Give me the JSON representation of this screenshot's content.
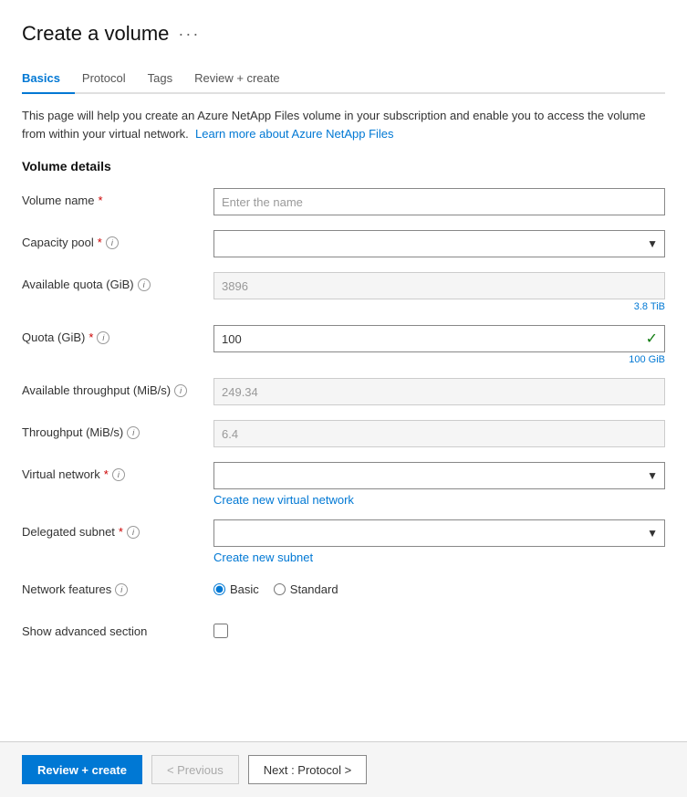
{
  "page": {
    "title": "Create a volume",
    "more_icon": "···"
  },
  "tabs": [
    {
      "id": "basics",
      "label": "Basics",
      "active": true
    },
    {
      "id": "protocol",
      "label": "Protocol",
      "active": false
    },
    {
      "id": "tags",
      "label": "Tags",
      "active": false
    },
    {
      "id": "review",
      "label": "Review + create",
      "active": false
    }
  ],
  "description": {
    "text": "This page will help you create an Azure NetApp Files volume in your subscription and enable you to access the volume from within your virtual network.",
    "link_text": "Learn more about Azure NetApp Files",
    "link_url": "#"
  },
  "section": {
    "title": "Volume details"
  },
  "fields": {
    "volume_name": {
      "label": "Volume name",
      "required": true,
      "placeholder": "Enter the name",
      "value": ""
    },
    "capacity_pool": {
      "label": "Capacity pool",
      "required": true,
      "has_info": true,
      "value": ""
    },
    "available_quota": {
      "label": "Available quota (GiB)",
      "has_info": true,
      "value": "3896",
      "sub_label": "3.8 TiB"
    },
    "quota": {
      "label": "Quota (GiB)",
      "required": true,
      "has_info": true,
      "value": "100",
      "sub_label": "100 GiB"
    },
    "available_throughput": {
      "label": "Available throughput (MiB/s)",
      "has_info": true,
      "value": "249.34"
    },
    "throughput": {
      "label": "Throughput (MiB/s)",
      "has_info": true,
      "value": "6.4"
    },
    "virtual_network": {
      "label": "Virtual network",
      "required": true,
      "has_info": true,
      "value": "",
      "create_link": "Create new virtual network"
    },
    "delegated_subnet": {
      "label": "Delegated subnet",
      "required": true,
      "has_info": true,
      "value": "",
      "create_link": "Create new subnet"
    },
    "network_features": {
      "label": "Network features",
      "has_info": true,
      "options": [
        "Basic",
        "Standard"
      ],
      "selected": "Basic"
    },
    "show_advanced": {
      "label": "Show advanced section",
      "checked": false
    }
  },
  "footer": {
    "review_create_label": "Review + create",
    "previous_label": "< Previous",
    "next_label": "Next : Protocol >"
  }
}
